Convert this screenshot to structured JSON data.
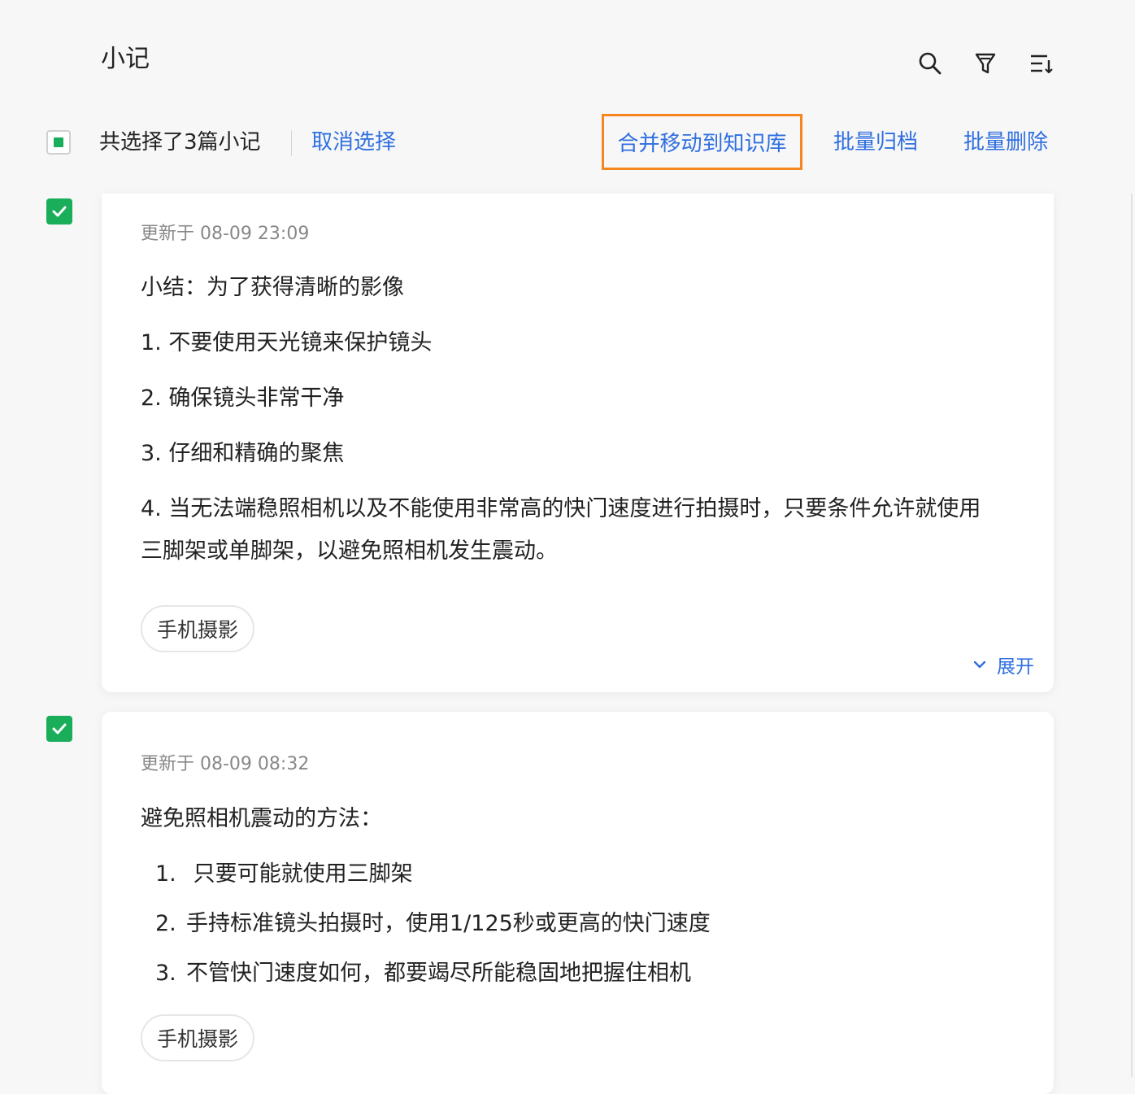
{
  "header": {
    "title": "小记",
    "icons": [
      "search-icon",
      "filter-icon",
      "sort-icon"
    ]
  },
  "selection_bar": {
    "count_text": "共选择了3篇小记",
    "cancel_label": "取消选择",
    "merge_label": "合并移动到知识库",
    "archive_label": "批量归档",
    "delete_label": "批量删除"
  },
  "notes": [
    {
      "selected": true,
      "updated": "更新于 08-09 23:09",
      "title": "小结：为了获得清晰的影像",
      "lines": [
        "1. 不要使用天光镜来保护镜头",
        "2. 确保镜头非常干净",
        "3. 仔细和精确的聚焦"
      ],
      "paragraph": "4. 当无法端稳照相机以及不能使用非常高的快门速度进行拍摄时，只要条件允许就使用三脚架或单脚架，以避免照相机发生震动。",
      "tag": "手机摄影",
      "expand_label": "展开"
    },
    {
      "selected": true,
      "updated": "更新于 08-09 08:32",
      "title": "避免照相机震动的方法：",
      "list": [
        {
          "num": "1.",
          "text": " 只要可能就使用三脚架"
        },
        {
          "num": "2.",
          "text": "手持标准镜头拍摄时，使用1/125秒或更高的快门速度"
        },
        {
          "num": "3.",
          "text": "不管快门速度如何，都要竭尽所能稳固地把握住相机"
        }
      ],
      "tag": "手机摄影"
    }
  ],
  "colors": {
    "accent": "#2f6fe0",
    "check_green": "#1aad5a",
    "highlight_border": "#f5861f",
    "background": "#f7f7f7"
  }
}
